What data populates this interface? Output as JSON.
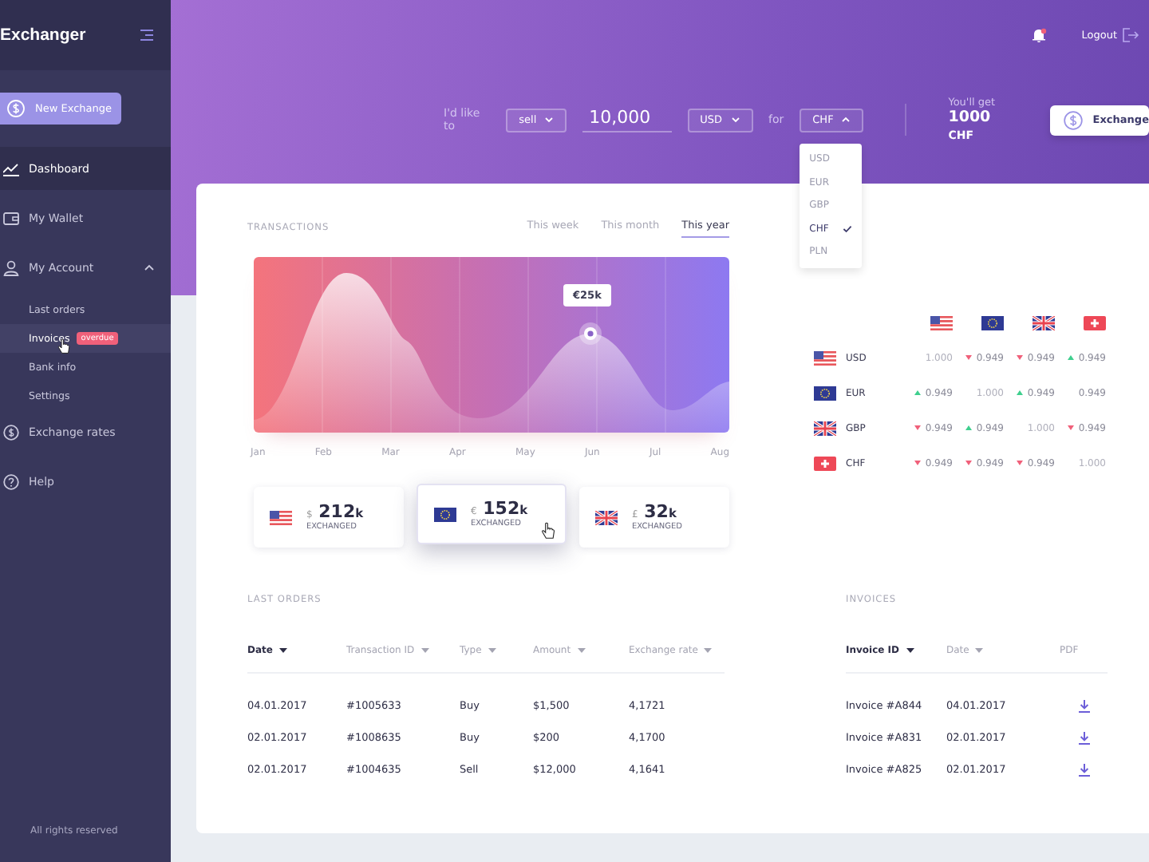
{
  "sidebar": {
    "logo": "Exchanger",
    "new_button": "New Exchange",
    "items": [
      {
        "label": "Dashboard",
        "selected": true
      },
      {
        "label": "My Wallet",
        "selected": false
      },
      {
        "label": "My Account",
        "selected": false,
        "expanded": true,
        "children": [
          {
            "label": "Last orders",
            "selected": false
          },
          {
            "label": "Invoices",
            "selected": true,
            "badge": "overdue"
          },
          {
            "label": "Bank info",
            "selected": false
          },
          {
            "label": "Settings",
            "selected": false
          }
        ]
      },
      {
        "label": "Exchange rates",
        "selected": false
      },
      {
        "label": "Help",
        "selected": false
      }
    ],
    "footer": "All rights reserved"
  },
  "header": {
    "notification": true,
    "logout": "Logout",
    "prompt": "I'd like to",
    "action": "sell",
    "amount": "10,000",
    "from": "USD",
    "for_label": "for",
    "to": "CHF",
    "to_open": true,
    "options": [
      {
        "label": "USD",
        "selected": false
      },
      {
        "label": "EUR",
        "selected": false
      },
      {
        "label": "GBP",
        "selected": false
      },
      {
        "label": "CHF",
        "selected": true
      },
      {
        "label": "PLN",
        "selected": false
      }
    ],
    "result_label": "You'll get",
    "result_amount": "1000",
    "result_currency": "CHF",
    "button": "Exchange"
  },
  "transactions": {
    "title": "TRANSACTIONS",
    "periods": [
      {
        "label": "This week",
        "selected": false
      },
      {
        "label": "This month",
        "selected": false
      },
      {
        "label": "This year",
        "selected": true
      }
    ],
    "tooltip": "€25k",
    "months": [
      "Jan",
      "Feb",
      "Mar",
      "Apr",
      "May",
      "Jun",
      "Jul",
      "Aug"
    ],
    "summaries": [
      {
        "kind": "us",
        "symbol": "$",
        "amount": "212",
        "unit": "k",
        "label": "EXCHANGED",
        "selected": false
      },
      {
        "kind": "eu",
        "symbol": "€",
        "amount": "152",
        "unit": "k",
        "label": "EXCHANGED",
        "selected": true
      },
      {
        "kind": "gb",
        "symbol": "£",
        "amount": "32",
        "unit": "k",
        "label": "EXCHANGED",
        "selected": false
      }
    ]
  },
  "rates": {
    "columns": [
      {
        "kind": "us"
      },
      {
        "kind": "eu"
      },
      {
        "kind": "gb"
      },
      {
        "kind": "ch"
      }
    ],
    "rows": [
      {
        "kind": "us",
        "code": "USD",
        "cells": [
          {
            "value": "1.000",
            "kind": "base"
          },
          {
            "value": "0.949",
            "kind": "down"
          },
          {
            "value": "0.949",
            "kind": "down"
          },
          {
            "value": "0.949",
            "kind": "up"
          }
        ]
      },
      {
        "kind": "eu",
        "code": "EUR",
        "cells": [
          {
            "value": "0.949",
            "kind": "up"
          },
          {
            "value": "1.000",
            "kind": "base"
          },
          {
            "value": "0.949",
            "kind": "up"
          },
          {
            "value": "0.949",
            "kind": "plain"
          }
        ]
      },
      {
        "kind": "gb",
        "code": "GBP",
        "cells": [
          {
            "value": "0.949",
            "kind": "down"
          },
          {
            "value": "0.949",
            "kind": "up"
          },
          {
            "value": "1.000",
            "kind": "base"
          },
          {
            "value": "0.949",
            "kind": "down"
          }
        ]
      },
      {
        "kind": "ch",
        "code": "CHF",
        "cells": [
          {
            "value": "0.949",
            "kind": "down"
          },
          {
            "value": "0.949",
            "kind": "down"
          },
          {
            "value": "0.949",
            "kind": "down"
          },
          {
            "value": "1.000",
            "kind": "base"
          }
        ]
      }
    ]
  },
  "orders": {
    "title": "LAST ORDERS",
    "columns": [
      {
        "label": "Date",
        "selected": true
      },
      {
        "label": "Transaction ID",
        "selected": false
      },
      {
        "label": "Type",
        "selected": false
      },
      {
        "label": "Amount",
        "selected": false
      },
      {
        "label": "Exchange rate",
        "selected": false
      }
    ],
    "rows": [
      [
        "04.01.2017",
        "#1005633",
        "Buy",
        "$1,500",
        "4,1721"
      ],
      [
        "02.01.2017",
        "#1008635",
        "Buy",
        "$200",
        "4,1700"
      ],
      [
        "02.01.2017",
        "#1004635",
        "Sell",
        "$12,000",
        "4,1641"
      ]
    ]
  },
  "invoices": {
    "title": "INVOICES",
    "columns": [
      {
        "label": "Invoice ID",
        "selected": true,
        "sortable": true
      },
      {
        "label": "Date",
        "selected": false,
        "sortable": true
      },
      {
        "label": "PDF",
        "selected": false,
        "sortable": false
      }
    ],
    "rows": [
      {
        "id": "Invoice #A844",
        "date": "04.01.2017"
      },
      {
        "id": "Invoice #A831",
        "date": "02.01.2017"
      },
      {
        "id": "Invoice #A825",
        "date": "02.01.2017"
      }
    ]
  }
}
